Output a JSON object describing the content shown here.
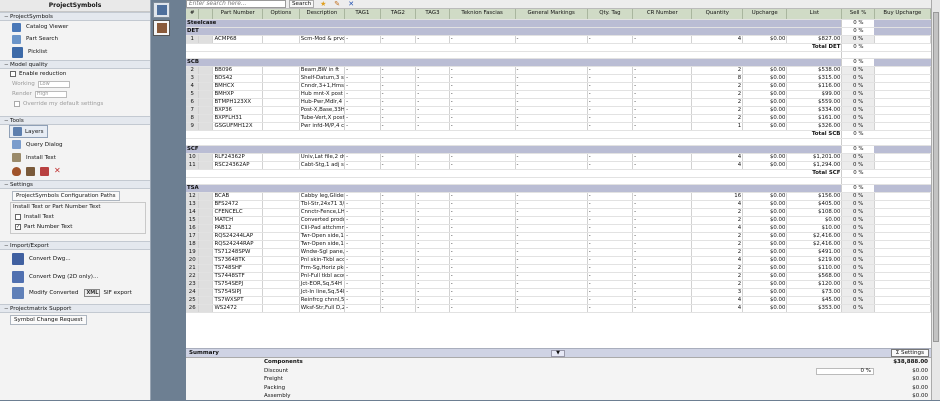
{
  "sidebar": {
    "title": "ProjectSymbols",
    "sections": {
      "project_symbols": {
        "label": "ProjectSymbols",
        "items": [
          "Catalog Viewer",
          "Part Search",
          "Picklist"
        ]
      },
      "model_quality": {
        "label": "Model quality",
        "enable_reduction": "Enable reduction",
        "working_label": "Working",
        "working_value": "Low",
        "render_label": "Render",
        "render_value": "High",
        "override": "Override my default settings"
      },
      "tools": {
        "label": "Tools",
        "items": [
          "Layers",
          "Query Dialog",
          "Install Text"
        ]
      },
      "settings": {
        "label": "Settings",
        "config_button": "ProjectSymbols Configuration Paths",
        "group_label": "Install Text or Part Number Text",
        "install_text": "Install Text",
        "part_number_text": "Part Number Text"
      },
      "import_export": {
        "label": "Import/Export",
        "convert_dwg": "Convert Dwg...",
        "convert_dwg_2d": "Convert Dwg (2D only)...",
        "modify_converted": "Modify Converted",
        "sif_export": "SIF export",
        "xml_badge": "XML"
      },
      "projectmatrix": {
        "label": "Projectmatrix Support",
        "button": "Symbol Change Request"
      }
    }
  },
  "toolbar": {
    "search_placeholder": "Enter search here...",
    "search_button": "Search"
  },
  "columns": [
    "#",
    "",
    "Part Number",
    "Options",
    "Description",
    "TAG1",
    "TAG2",
    "TAG3",
    "Teknion Fascias",
    "General Markings",
    "Qty. Tag",
    "CR Number",
    "Quantity",
    "Upcharge",
    "List",
    "Sell %",
    "Buy Upcharge"
  ],
  "table": {
    "top_label": "Steelcase",
    "top_pct": "0 %",
    "groups": [
      {
        "name": "DET",
        "pct": "0 %",
        "rows": [
          {
            "n": "1",
            "part": "ACMP68",
            "desc": "Scm-Mod & prvcy,C",
            "qty": "4",
            "up": "$0.00",
            "list": "$827.00",
            "sell": "0 %"
          }
        ],
        "total_label": "Total DET",
        "total_pct": "0 %"
      },
      {
        "name": "SCB",
        "pct": "0 %",
        "rows": [
          {
            "n": "2",
            "part": "BB096",
            "desc": "Beam,BW in ft",
            "qty": "2",
            "up": "$0.00",
            "list": "$538.00",
            "sell": "0 %"
          },
          {
            "n": "3",
            "part": "BDS42",
            "desc": "Shelf-Datum,3 sprt",
            "qty": "8",
            "up": "$0.00",
            "list": "$315.00",
            "sell": "0 %"
          },
          {
            "n": "4",
            "part": "BMHCX",
            "desc": "Cnndr,3+1,Hms to",
            "qty": "2",
            "up": "$0.00",
            "list": "$116.00",
            "sell": "0 %"
          },
          {
            "n": "5",
            "part": "BMHXP",
            "desc": "Hub mnt-X post",
            "qty": "2",
            "up": "$0.00",
            "list": "$99.00",
            "sell": "0 %"
          },
          {
            "n": "6",
            "part": "BTMPH123XX",
            "desc": "Hub-Pwr,Mdlr,4 circ",
            "qty": "2",
            "up": "$0.00",
            "list": "$559.00",
            "sell": "0 %"
          },
          {
            "n": "7",
            "part": "BXP36",
            "desc": "Post-X,Base,33H",
            "qty": "2",
            "up": "$0.00",
            "list": "$334.00",
            "sell": "0 %"
          },
          {
            "n": "8",
            "part": "BXPFLH31",
            "desc": "Tube-Vert,X post,Fl",
            "qty": "2",
            "up": "$0.00",
            "list": "$161.00",
            "sell": "0 %"
          },
          {
            "n": "9",
            "part": "GSGUFMH12X",
            "desc": "Pwr infd-M/P,4 circ",
            "qty": "1",
            "up": "$0.00",
            "list": "$326.00",
            "sell": "0 %"
          }
        ],
        "total_label": "Total SCB",
        "total_pct": "0 %"
      },
      {
        "name": "SCF",
        "pct": "0 %",
        "rows": [
          {
            "n": "10",
            "part": "RLF24362P",
            "desc": "Univ,Lat file,2 dwrs,",
            "qty": "4",
            "up": "$0.00",
            "list": "$1,201.00",
            "sell": "0 %"
          },
          {
            "n": "11",
            "part": "RSC24362AP",
            "desc": "Cabt-Stg,1 adj shelf",
            "qty": "4",
            "up": "$0.00",
            "list": "$1,294.00",
            "sell": "0 %"
          }
        ],
        "total_label": "Total SCF",
        "total_pct": "0 %"
      },
      {
        "name": "TSA",
        "pct": "0 %",
        "rows": [
          {
            "n": "12",
            "part": "BCAB",
            "desc": "Cabby leg,Glides,2d",
            "qty": "16",
            "up": "$0.00",
            "list": "$156.00",
            "sell": "0 %"
          },
          {
            "n": "13",
            "part": "BFS2472",
            "desc": "Tbl-Str,24x71 3/4",
            "qty": "4",
            "up": "$0.00",
            "list": "$405.00",
            "sell": "0 %"
          },
          {
            "n": "14",
            "part": "CFENCELC",
            "desc": "Cnnctr-Fence,LH,Te",
            "qty": "2",
            "up": "$0.00",
            "list": "$108.00",
            "sell": "0 %"
          },
          {
            "n": "15",
            "part": "MATCH",
            "desc": "Converted product r",
            "qty": "2",
            "up": "$0.00",
            "list": "$0.00",
            "sell": "0 %"
          },
          {
            "n": "16",
            "part": "PAB12",
            "desc": "Clil-Pad attchmnt",
            "qty": "4",
            "up": "$0.00",
            "list": "$10.00",
            "sell": "0 %"
          },
          {
            "n": "17",
            "part": "RQS24244LAP",
            "desc": "Twr-Open side,1 ad",
            "qty": "2",
            "up": "$0.00",
            "list": "$2,416.00",
            "sell": "0 %"
          },
          {
            "n": "18",
            "part": "RQS24244RAP",
            "desc": "Twr-Open side,1 ad",
            "qty": "2",
            "up": "$0.00",
            "list": "$2,416.00",
            "sell": "0 %"
          },
          {
            "n": "19",
            "part": "TS71248SPW",
            "desc": "Wndw-Sgl pane,12x",
            "qty": "2",
            "up": "$0.00",
            "list": "$491.00",
            "sell": "0 %"
          },
          {
            "n": "20",
            "part": "TS73648TK",
            "desc": "Pnl skin-Tkbl acoust",
            "qty": "4",
            "up": "$0.00",
            "list": "$219.00",
            "sell": "0 %"
          },
          {
            "n": "21",
            "part": "TS748SHF",
            "desc": "Frm-Sg,Horiz pkg,6",
            "qty": "2",
            "up": "$0.00",
            "list": "$110.00",
            "sell": "0 %"
          },
          {
            "n": "22",
            "part": "TS7448STF",
            "desc": "Pnl-Full tkbl acoust,",
            "qty": "2",
            "up": "$0.00",
            "list": "$568.00",
            "sell": "0 %"
          },
          {
            "n": "23",
            "part": "TS754SEPJ",
            "desc": "Jct-EOR,Sq,54H",
            "qty": "2",
            "up": "$0.00",
            "list": "$120.00",
            "sell": "0 %"
          },
          {
            "n": "24",
            "part": "TS754SIPJ",
            "desc": "Jct-In line,Sq,54H",
            "qty": "3",
            "up": "$0.00",
            "list": "$73.00",
            "sell": "0 %"
          },
          {
            "n": "25",
            "part": "TS7WXSPT",
            "desc": "Reinfrcg chnnl,57W",
            "qty": "4",
            "up": "$0.00",
            "list": "$45.00",
            "sell": "0 %"
          },
          {
            "n": "26",
            "part": "WS2472",
            "desc": "Wksf-Str,Full D,24x",
            "qty": "4",
            "up": "$0.00",
            "list": "$353.00",
            "sell": "0 %"
          }
        ]
      }
    ]
  },
  "summary": {
    "title": "Summary",
    "settings_button": "Settings",
    "rows": [
      {
        "label": "Components",
        "bold": true,
        "pct": "",
        "value": "$38,888.00"
      },
      {
        "label": "Discount",
        "bold": false,
        "pct": "0 %",
        "value": "$0.00"
      },
      {
        "label": "Freight",
        "bold": false,
        "pct": "",
        "value": "$0.00"
      },
      {
        "label": "Packing",
        "bold": false,
        "pct": "",
        "value": "$0.00"
      },
      {
        "label": "Assembly",
        "bold": false,
        "pct": "",
        "value": "$0.00"
      }
    ]
  },
  "dash": "-",
  "colors": {
    "header_green": "#d0dbc6",
    "group_band": "#babdd4",
    "sidebar_section": "#e4e8ee",
    "backdrop": "#6d7f92"
  }
}
